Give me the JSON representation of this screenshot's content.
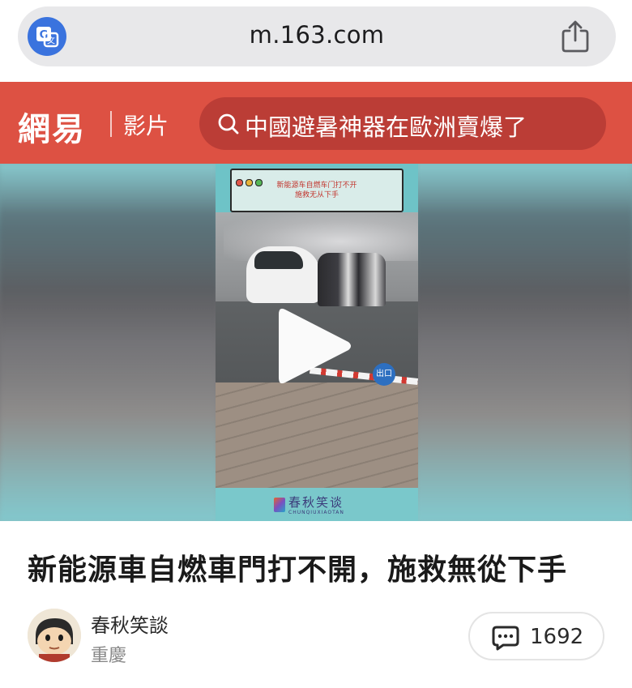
{
  "browser": {
    "url": "m.163.com",
    "translate_icon": "translate-icon",
    "share_icon": "share-icon"
  },
  "header": {
    "logo": "網易",
    "section": "影片",
    "search_icon": "search-icon",
    "search_text": "中國避暑神器在歐洲賣爆了",
    "brand_color": "#dd5143"
  },
  "video": {
    "caption_line1": "新能源车自燃车门打不开",
    "caption_line2": "施救无从下手",
    "exit_sign": "出口",
    "watermark_name": "春秋笑谈",
    "watermark_sub": "CHUNQIUXIAOTAN",
    "play_icon": "play-icon"
  },
  "article": {
    "title": "新能源車自燃車門打不開，施救無從下手",
    "author_name": "春秋笑談",
    "author_location": "重慶",
    "comment_icon": "comment-icon",
    "comment_count": "1692"
  }
}
